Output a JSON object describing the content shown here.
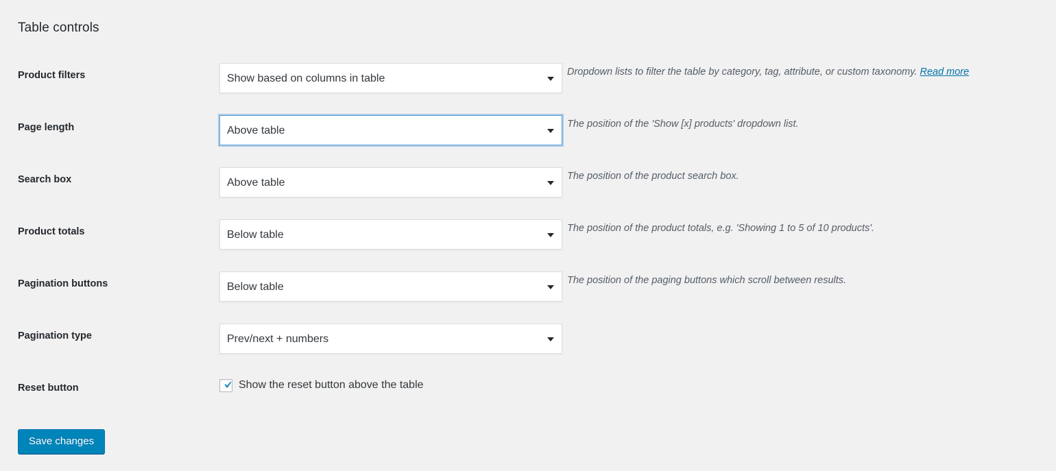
{
  "page": {
    "title": "Table controls",
    "save_label": "Save changes"
  },
  "rows": [
    {
      "label": "Product filters",
      "control": "select",
      "value": "Show based on columns in table",
      "description": "Dropdown lists to filter the table by category, tag, attribute, or custom taxonomy.",
      "link_label": "Read more",
      "focused": false
    },
    {
      "label": "Page length",
      "control": "select",
      "value": "Above table",
      "description": "The position of the 'Show [x] products' dropdown list.",
      "link_label": "",
      "focused": true
    },
    {
      "label": "Search box",
      "control": "select",
      "value": "Above table",
      "description": "The position of the product search box.",
      "link_label": "",
      "focused": false
    },
    {
      "label": "Product totals",
      "control": "select",
      "value": "Below table",
      "description": "The position of the product totals, e.g. 'Showing 1 to 5 of 10 products'.",
      "link_label": "",
      "focused": false
    },
    {
      "label": "Pagination buttons",
      "control": "select",
      "value": "Below table",
      "description": "The position of the paging buttons which scroll between results.",
      "link_label": "",
      "focused": false
    },
    {
      "label": "Pagination type",
      "control": "select",
      "value": "Prev/next + numbers",
      "description": "",
      "link_label": "",
      "focused": false
    },
    {
      "label": "Reset button",
      "control": "checkbox",
      "value": "",
      "checkbox_label": "Show the reset button above the table",
      "checked": true,
      "description": "",
      "link_label": "",
      "focused": false
    }
  ],
  "colors": {
    "background": "#f1f1f1",
    "accent": "#0085ba",
    "link": "#0073aa",
    "focus_border": "#5b9dd9",
    "text": "#23282d",
    "description_text": "#555d66"
  }
}
